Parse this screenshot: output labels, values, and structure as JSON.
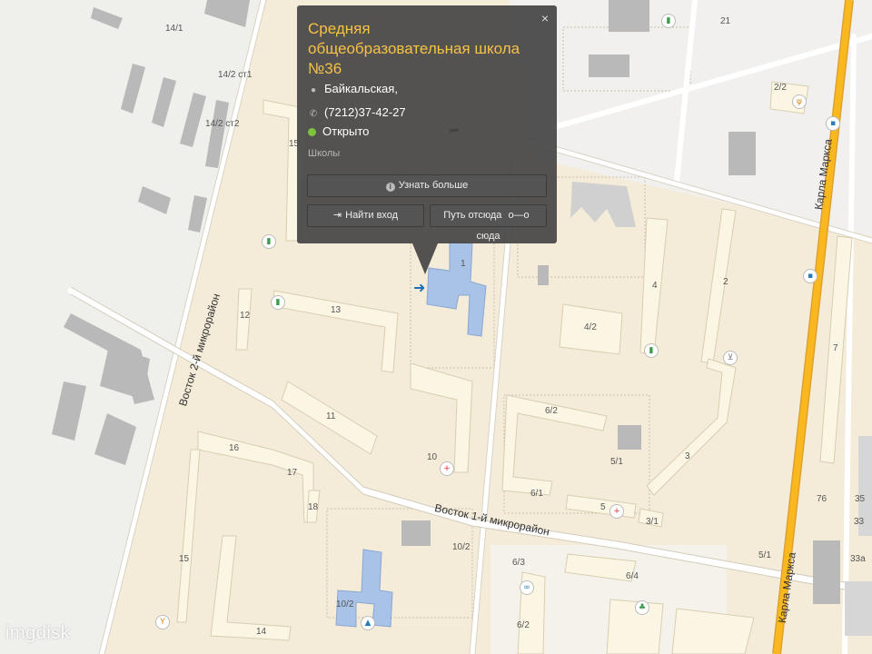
{
  "popup": {
    "title": "Средняя общеобразовательная школа №36",
    "close_label": "×",
    "address": "Байкальская,",
    "phone": "(7212)37-42-27",
    "status": "Открыто",
    "category": "Школы",
    "more_button": "Узнать больше",
    "entrance_button": "Найти вход",
    "route_from": "Путь отсюда",
    "route_to": "сюда",
    "status_color": "#7ec33c",
    "title_color": "#f5c244"
  },
  "map": {
    "streets": {
      "vostok1": "Восток 1-й микрорайон",
      "vostok2": "Восток 2-й микрорайон",
      "karla_marksa_1": "Карла Маркса",
      "karla_marksa_2": "Карла Маркса"
    },
    "building_labels": {
      "b14_1": "14/1",
      "b14_2st1": "14/2 ст1",
      "b14_2st2": "14/2 ст2",
      "b15a": "15",
      "b12": "12",
      "b13": "13",
      "b11": "11",
      "b16": "16",
      "b17": "17",
      "b18": "18",
      "b15b": "15",
      "b14": "14",
      "b10_2a": "10/2",
      "b10_2b": "10/2",
      "b10": "10",
      "b1": "1",
      "b21": "21",
      "b2_2": "2/2",
      "b4": "4",
      "b4_2": "4/2",
      "b2": "2",
      "b6_2a": "6/2",
      "b5_1": "5/1",
      "b6_1": "6/1",
      "b5": "5",
      "b3_1": "3/1",
      "b3": "3",
      "b6_3": "6/3",
      "b6_4": "6/4",
      "b6_2b": "6/2",
      "b7": "7",
      "b76": "76",
      "b5_1b": "5/1",
      "b35": "35",
      "b33": "33",
      "b33a": "33а"
    }
  },
  "watermark": "imgdisk"
}
